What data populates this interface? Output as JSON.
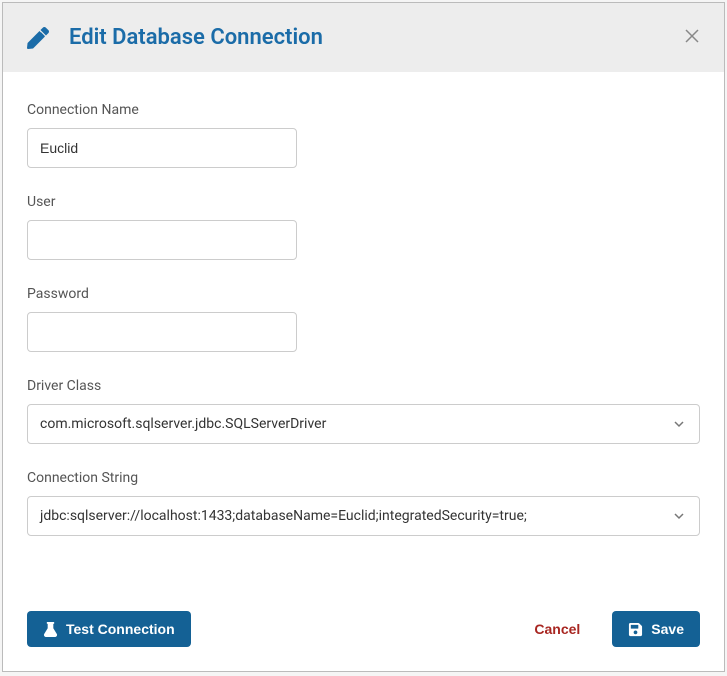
{
  "header": {
    "title": "Edit Database Connection"
  },
  "form": {
    "connectionName": {
      "label": "Connection Name",
      "value": "Euclid"
    },
    "user": {
      "label": "User",
      "value": ""
    },
    "password": {
      "label": "Password",
      "value": ""
    },
    "driverClass": {
      "label": "Driver Class",
      "value": "com.microsoft.sqlserver.jdbc.SQLServerDriver"
    },
    "connectionString": {
      "label": "Connection String",
      "value": "jdbc:sqlserver://localhost:1433;databaseName=Euclid;integratedSecurity=true;"
    }
  },
  "footer": {
    "testConnection": "Test Connection",
    "cancel": "Cancel",
    "save": "Save"
  }
}
